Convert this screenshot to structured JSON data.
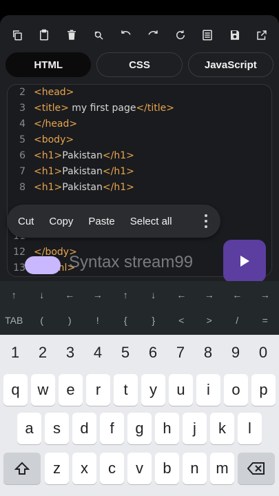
{
  "toolbar": {
    "icons": [
      "copy-icon",
      "clipboard-icon",
      "trash-icon",
      "find-replace-icon",
      "undo-icon",
      "redo-icon",
      "refresh-icon",
      "list-icon",
      "save-icon",
      "open-external-icon"
    ]
  },
  "tabs": [
    {
      "label": "HTML",
      "active": true
    },
    {
      "label": "CSS",
      "active": false
    },
    {
      "label": "JavaScript",
      "active": false
    }
  ],
  "editor": {
    "lines": [
      {
        "n": "2",
        "parts": [
          [
            "tag",
            "<head>"
          ]
        ]
      },
      {
        "n": "3",
        "parts": [
          [
            "tag",
            "<title>"
          ],
          [
            "txt",
            " my first page"
          ],
          [
            "tag",
            "</title>"
          ]
        ]
      },
      {
        "n": "4",
        "parts": [
          [
            "tag",
            "</head>"
          ]
        ]
      },
      {
        "n": "5",
        "parts": [
          [
            "tag",
            "<body>"
          ]
        ]
      },
      {
        "n": "6",
        "parts": [
          [
            "tag",
            "<h1>"
          ],
          [
            "txt",
            "Pakistan"
          ],
          [
            "tag",
            "</h1>"
          ]
        ]
      },
      {
        "n": "7",
        "parts": [
          [
            "tag",
            "<h1>"
          ],
          [
            "txt",
            "Pakistan"
          ],
          [
            "tag",
            "</h1>"
          ]
        ]
      },
      {
        "n": "8",
        "parts": [
          [
            "tag",
            "<h1>"
          ],
          [
            "txt",
            "Pakistan"
          ],
          [
            "tag",
            "</h1>"
          ]
        ]
      },
      {
        "n": "11",
        "parts": []
      },
      {
        "n": "12",
        "parts": [
          [
            "tag",
            "</body>"
          ]
        ]
      },
      {
        "n": "13",
        "parts": [
          [
            "tag",
            "</html>"
          ]
        ]
      }
    ]
  },
  "context_menu": {
    "items": [
      "Cut",
      "Copy",
      "Paste",
      "Select all"
    ]
  },
  "watermark": "Syntax stream99",
  "symbols": {
    "row1": [
      "↑",
      "↓",
      "←",
      "→",
      "↑",
      "↓",
      "←",
      "→",
      "←",
      "→"
    ],
    "row2": [
      "TAB",
      "(",
      ")",
      "!",
      "{",
      "}",
      "<",
      ">",
      "/",
      "="
    ]
  },
  "keyboard": {
    "numbers": [
      "1",
      "2",
      "3",
      "4",
      "5",
      "6",
      "7",
      "8",
      "9",
      "0"
    ],
    "row1": [
      "q",
      "w",
      "e",
      "r",
      "t",
      "y",
      "u",
      "i",
      "o",
      "p"
    ],
    "row2": [
      "a",
      "s",
      "d",
      "f",
      "g",
      "h",
      "j",
      "k",
      "l"
    ],
    "row3": [
      "z",
      "x",
      "c",
      "v",
      "b",
      "n",
      "m"
    ]
  },
  "colors": {
    "tag": "#e8a64f",
    "run_button": "#5b3ea0",
    "app_bg": "#1e1f22"
  }
}
